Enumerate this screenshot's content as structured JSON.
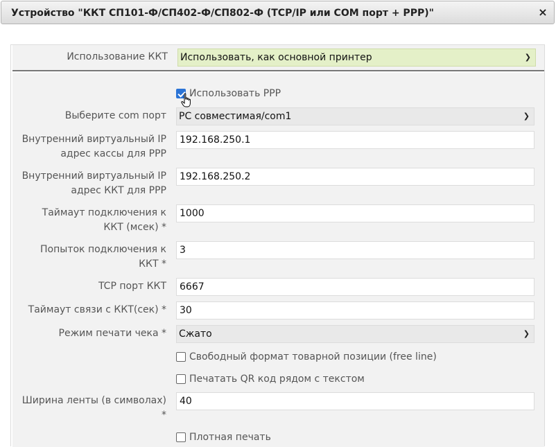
{
  "dialog": {
    "title": "Устройство \"ККТ СП101-Ф/СП402-Ф/СП802-Ф (TCP/IP или COM порт + PPP)\"",
    "close": "×"
  },
  "usage": {
    "label": "Использование ККТ",
    "value": "Использовать, как основной принтер"
  },
  "use_ppp": {
    "label": "Использовать PPP",
    "checked": true
  },
  "com_port": {
    "label": "Выберите com порт",
    "value": "PC совместимая/com1"
  },
  "ip_kassa": {
    "label_1": "Внутренний виртуальный IP",
    "label_2": "адрес кассы для PPP",
    "value": "192.168.250.1"
  },
  "ip_kkt": {
    "label_1": "Внутренний виртуальный IP",
    "label_2": "адрес ККТ для PPP",
    "value": "192.168.250.2"
  },
  "conn_timeout": {
    "label_1": "Таймаут подключения к",
    "label_2": "ККТ (мсек) *",
    "value": "1000"
  },
  "conn_attempts": {
    "label_1": "Попыток подключения к",
    "label_2": "ККТ *",
    "value": "3"
  },
  "tcp_port": {
    "label": "TCP порт ККТ",
    "value": "6667"
  },
  "comm_timeout": {
    "label": "Таймаут связи с ККТ(сек) *",
    "value": "30"
  },
  "print_mode": {
    "label": "Режим печати чека *",
    "value": "Сжато"
  },
  "free_line": {
    "label": "Свободный формат товарной позиции (free line)",
    "checked": false
  },
  "qr_print": {
    "label": "Печатать QR код рядом с текстом",
    "checked": false
  },
  "tape_width": {
    "label_1": "Ширина ленты (в символах)",
    "label_2": "*",
    "value": "40"
  },
  "dense_print": {
    "label": "Плотная печать",
    "checked": false
  }
}
